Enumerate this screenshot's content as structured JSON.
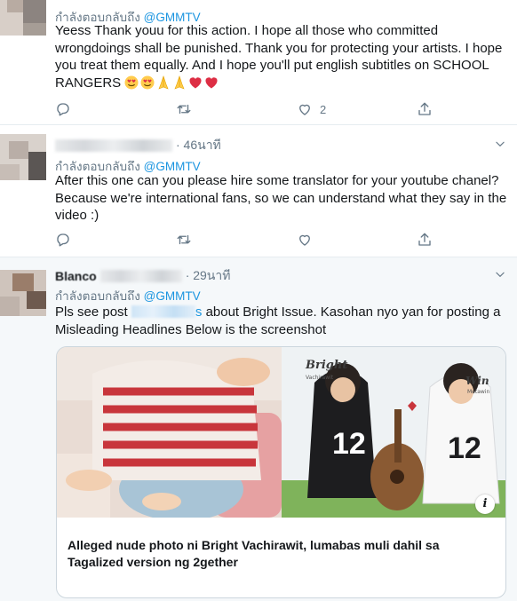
{
  "tweets": [
    {
      "replying_prefix": "กำลังตอบกลับถึง",
      "mention": "@GMMTV",
      "text": "Yeess Thank youu for this action. I hope all those who committed wrongdoings shall be punished. Thank you for protecting your artists. I hope you treat them equally. And I hope you'll put english subtitles on SCHOOL RANGERS",
      "emojis": [
        "heart-eyes",
        "heart-eyes",
        "folded-hands",
        "folded-hands",
        "red-heart",
        "red-heart"
      ],
      "like_count": "2"
    },
    {
      "timestamp": "· 46นาที",
      "replying_prefix": "กำลังตอบกลับถึง",
      "mention": "@GMMTV",
      "text": "After this one can you please hire some translator for your youtube chanel? Because we're international fans, so we can understand what they say in the video :)"
    },
    {
      "name": "Blanco",
      "timestamp": "· 29นาที",
      "replying_prefix": "กำลังตอบกลับถึง",
      "mention": "@GMMTV",
      "text_before_link": "Pls see post",
      "link_tail": "s",
      "text_after_link": "about Bright Issue. Kasohan nyo yan for posting a Misleading Headlines Below is the screenshot",
      "card": {
        "title": "Alleged nude photo ni Bright Vachirawit, lumabas muli dahil sa Tagalized version ng 2gether",
        "image_label_left": "Bright",
        "image_sub_left": "Vachirawit",
        "image_label_right": "Win",
        "image_sub_right": "Metawin",
        "jersey_number_1": "12",
        "jersey_number_2": "12",
        "info_icon": "i"
      }
    }
  ],
  "icons": {
    "reply": "reply-icon",
    "retweet": "retweet-icon",
    "like": "heart-icon",
    "share": "share-icon",
    "caret": "chevron-down-icon"
  },
  "colors": {
    "link": "#1b95e0",
    "secondary_text": "#657786",
    "border": "#e6ecf0"
  }
}
